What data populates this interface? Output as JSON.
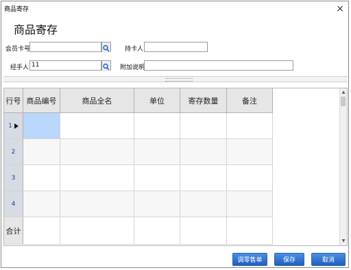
{
  "window": {
    "title": "商品寄存",
    "close_glyph": "×"
  },
  "form": {
    "heading": "商品寄存",
    "member_card": {
      "label": "会员卡号",
      "value": ""
    },
    "holder": {
      "label": "持卡人",
      "value": ""
    },
    "handler": {
      "label": "经手人",
      "value": "11"
    },
    "note": {
      "label": "附加说明",
      "value": ""
    },
    "lookup_icon": "search-icon"
  },
  "grid": {
    "columns": [
      "行号",
      "商品编号",
      "商品全名",
      "单位",
      "寄存数量",
      "备注"
    ],
    "rows": [
      {
        "num": "1",
        "current": true
      },
      {
        "num": "2",
        "current": false
      },
      {
        "num": "3",
        "current": false
      },
      {
        "num": "4",
        "current": false
      }
    ],
    "total_label": "合计",
    "scroll_up": "▲",
    "scroll_down": "▼"
  },
  "buttons": {
    "tuning": "调零售单",
    "save": "保存",
    "cancel": "取消"
  },
  "colors": {
    "selected_cell": "#b9d6fb",
    "button_blue": "#2f73d3",
    "row_header": "#d7dbe4"
  }
}
